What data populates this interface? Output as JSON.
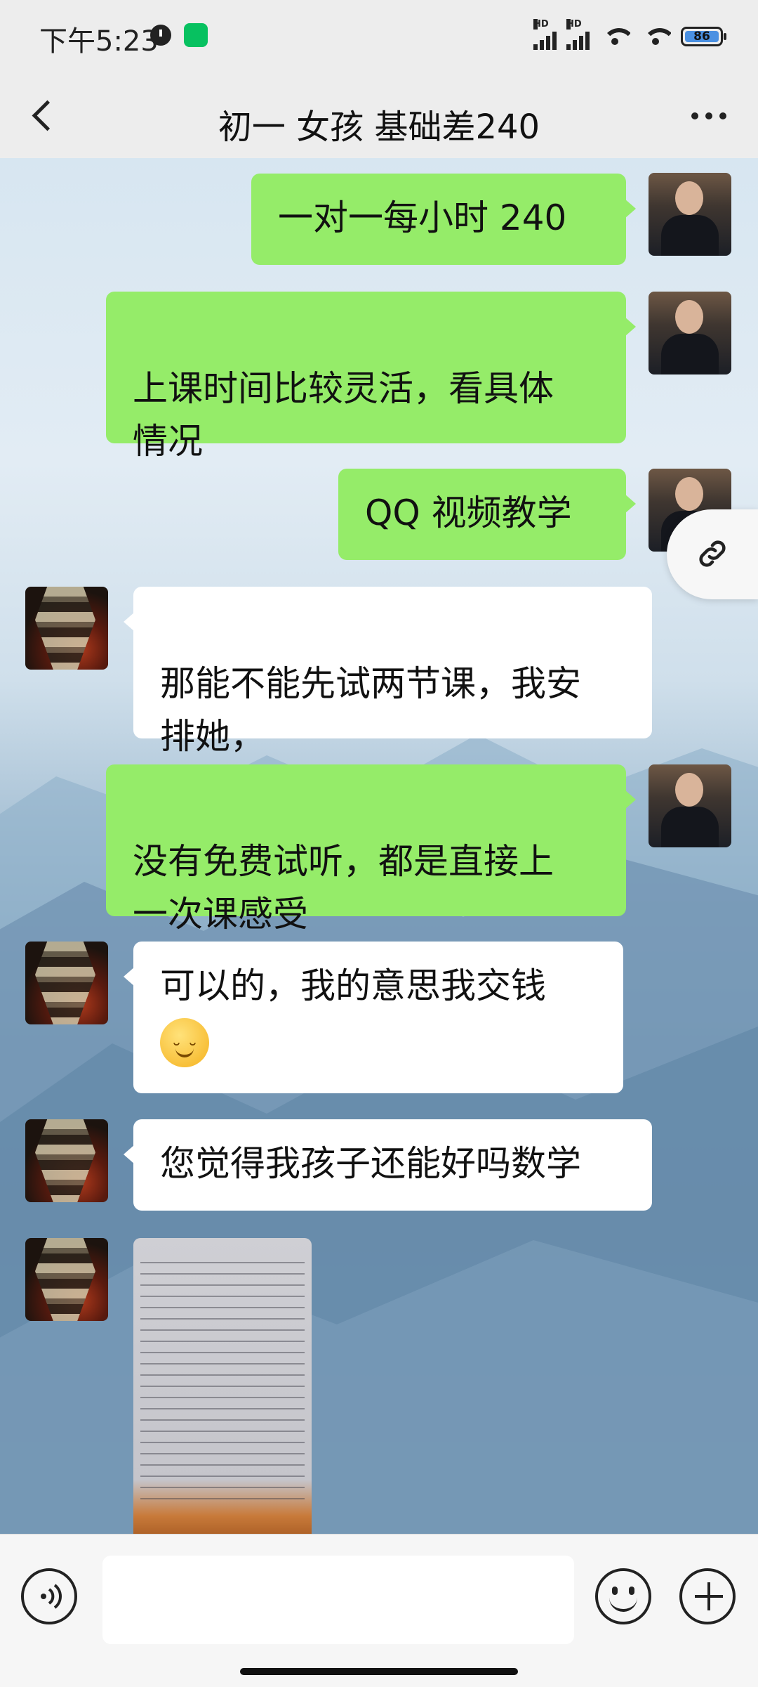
{
  "status_bar": {
    "time": "下午5:23",
    "signal_labels": [
      "HD",
      "HD"
    ],
    "battery": "86"
  },
  "header": {
    "title": "初一 女孩 基础差240"
  },
  "messages": [
    {
      "sender": "me",
      "text": "一对一每小时 240"
    },
    {
      "sender": "me",
      "text": "上课时间比较灵活，看具体\n情况"
    },
    {
      "sender": "me",
      "text": "QQ 视频教学"
    },
    {
      "sender": "other",
      "text": "那能不能先试两节课，我安\n排她，"
    },
    {
      "sender": "me",
      "text": "没有免费试听，都是直接上\n一次课感受"
    },
    {
      "sender": "other",
      "text": "可以的，我的意思我交钱",
      "emoji": "shy-smile"
    },
    {
      "sender": "other",
      "text": "您觉得我孩子还能好吗数学"
    },
    {
      "sender": "other",
      "type": "image",
      "content": "photo of math homework sheet"
    }
  ],
  "input_bar": {
    "placeholder": ""
  },
  "icons": [
    "back-arrow-icon",
    "more-icon",
    "link-icon",
    "voice-icon",
    "emoji-icon",
    "plus-icon"
  ],
  "colors": {
    "my_bubble": "#95ec69",
    "other_bubble": "#ffffff",
    "bar_bg": "#ededed"
  }
}
